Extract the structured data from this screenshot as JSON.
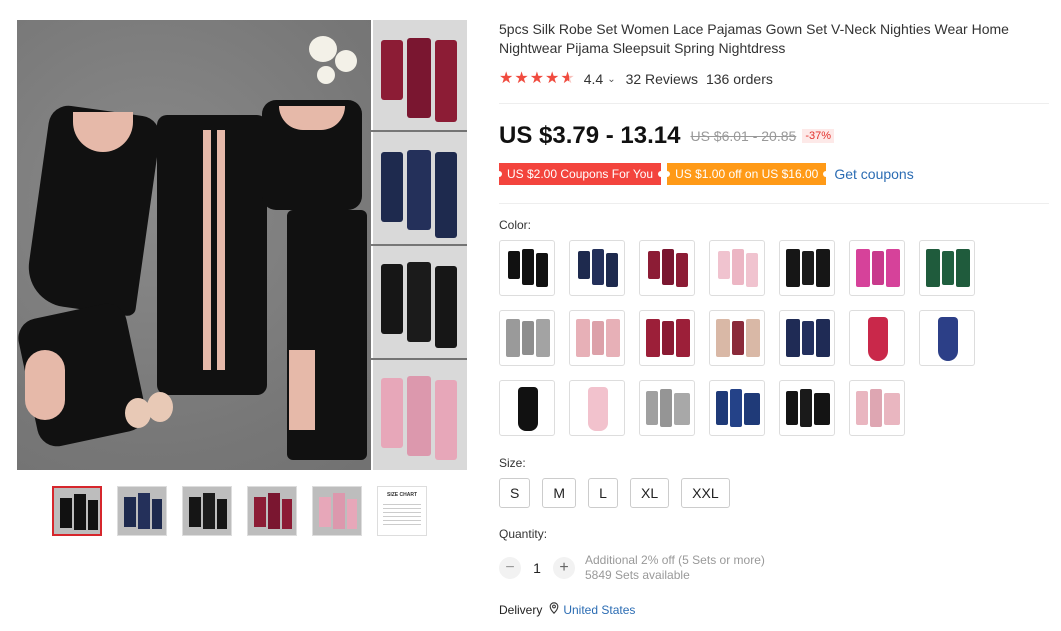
{
  "product": {
    "title": "5pcs Silk Robe Set Women Lace Pajamas Gown Set V-Neck Nighties Wear Home Nightwear Pijama Sleepsuit Spring Nightdress",
    "rating": "4.4",
    "rating_stars": 4.5,
    "reviews": "32 Reviews",
    "orders": "136 orders"
  },
  "price": {
    "current": "US $3.79 - 13.14",
    "original": "US $6.01 - 20.85",
    "discount": "-37%"
  },
  "coupons": {
    "coupon1": "US $2.00 Coupons For You",
    "coupon2": "US $1.00 off on US $16.00",
    "get_coupons": "Get coupons"
  },
  "color_label": "Color:",
  "colors": [
    "black",
    "navy",
    "wine red",
    "pink",
    "black",
    "rose",
    "green",
    "grey",
    "pink",
    "wine red",
    "champagne",
    "navy",
    "red",
    "blue",
    "black",
    "pink",
    "grey",
    "navy",
    "black",
    "pink"
  ],
  "size_label": "Size:",
  "sizes": [
    "S",
    "M",
    "L",
    "XL",
    "XXL"
  ],
  "quantity_label": "Quantity:",
  "quantity": {
    "value": "1",
    "minus": "−",
    "plus": "+",
    "promo": "Additional 2% off (5 Sets or more)",
    "available": "5849 Sets available"
  },
  "delivery": {
    "label": "Delivery",
    "country": "United States"
  },
  "gallery": {
    "size_chart_title": "SIZE CHART"
  },
  "icons": {
    "star": "star-icon",
    "chevron": "chevron-down-icon",
    "pin": "location-pin-icon"
  },
  "theme": {
    "accent_red": "#f3443d",
    "accent_orange": "#ff9a17",
    "link_blue": "#2b6cb3",
    "star_red": "#f04b3f"
  }
}
